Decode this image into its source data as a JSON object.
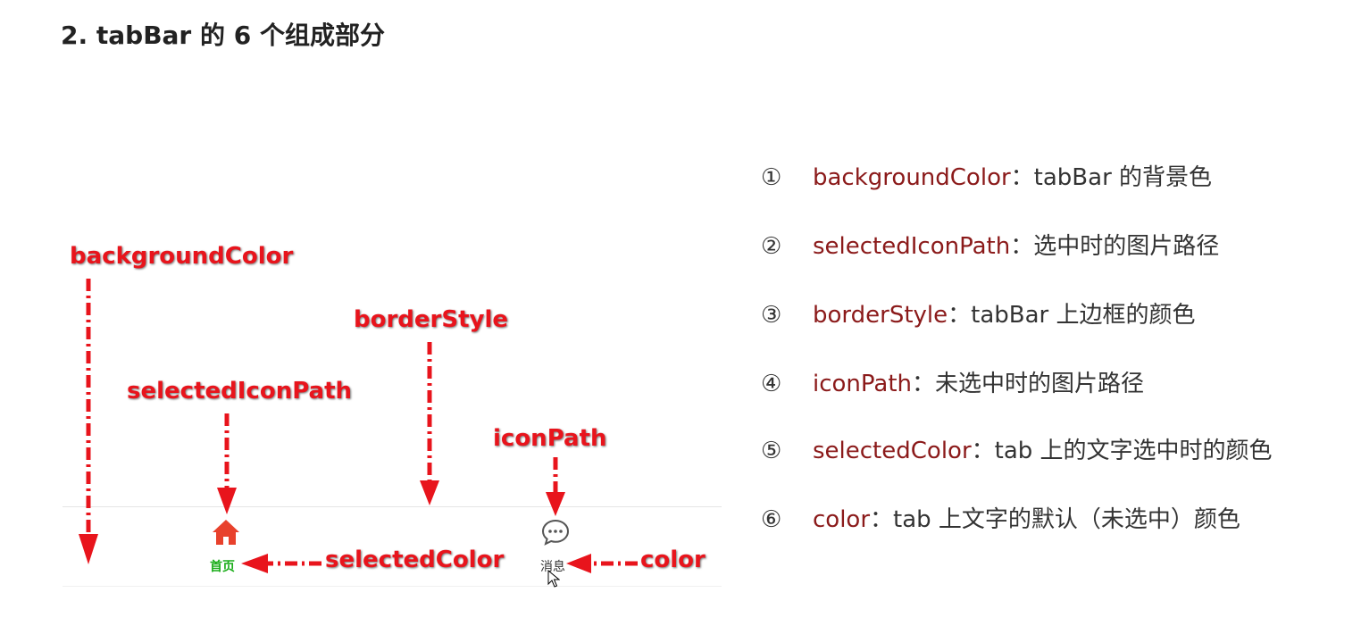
{
  "title": "2. tabBar 的 6 个组成部分",
  "diagram": {
    "labels": {
      "backgroundColor": "backgroundColor",
      "borderStyle": "borderStyle",
      "selectedIconPath": "selectedIconPath",
      "iconPath": "iconPath",
      "selectedColor": "selectedColor",
      "color": "color"
    },
    "tabbar": {
      "home_label": "首页",
      "message_label": "消息",
      "home_color": "#1aad19",
      "message_color": "#333333",
      "home_icon": "home-icon",
      "message_icon": "chat-bubble-icon"
    },
    "arrow_color": "#e8141c"
  },
  "items": [
    {
      "num": "①",
      "key": "backgroundColor",
      "desc": "：tabBar 的背景色"
    },
    {
      "num": "②",
      "key": "selectedIconPath",
      "desc": "：选中时的图片路径"
    },
    {
      "num": "③",
      "key": "borderStyle",
      "desc": "：tabBar 上边框的颜色"
    },
    {
      "num": "④",
      "key": "iconPath",
      "desc": "：未选中时的图片路径"
    },
    {
      "num": "⑤",
      "key": "selectedColor",
      "desc": "：tab 上的文字选中时的颜色"
    },
    {
      "num": "⑥",
      "key": "color",
      "desc": "：tab 上文字的默认（未选中）颜色"
    }
  ]
}
